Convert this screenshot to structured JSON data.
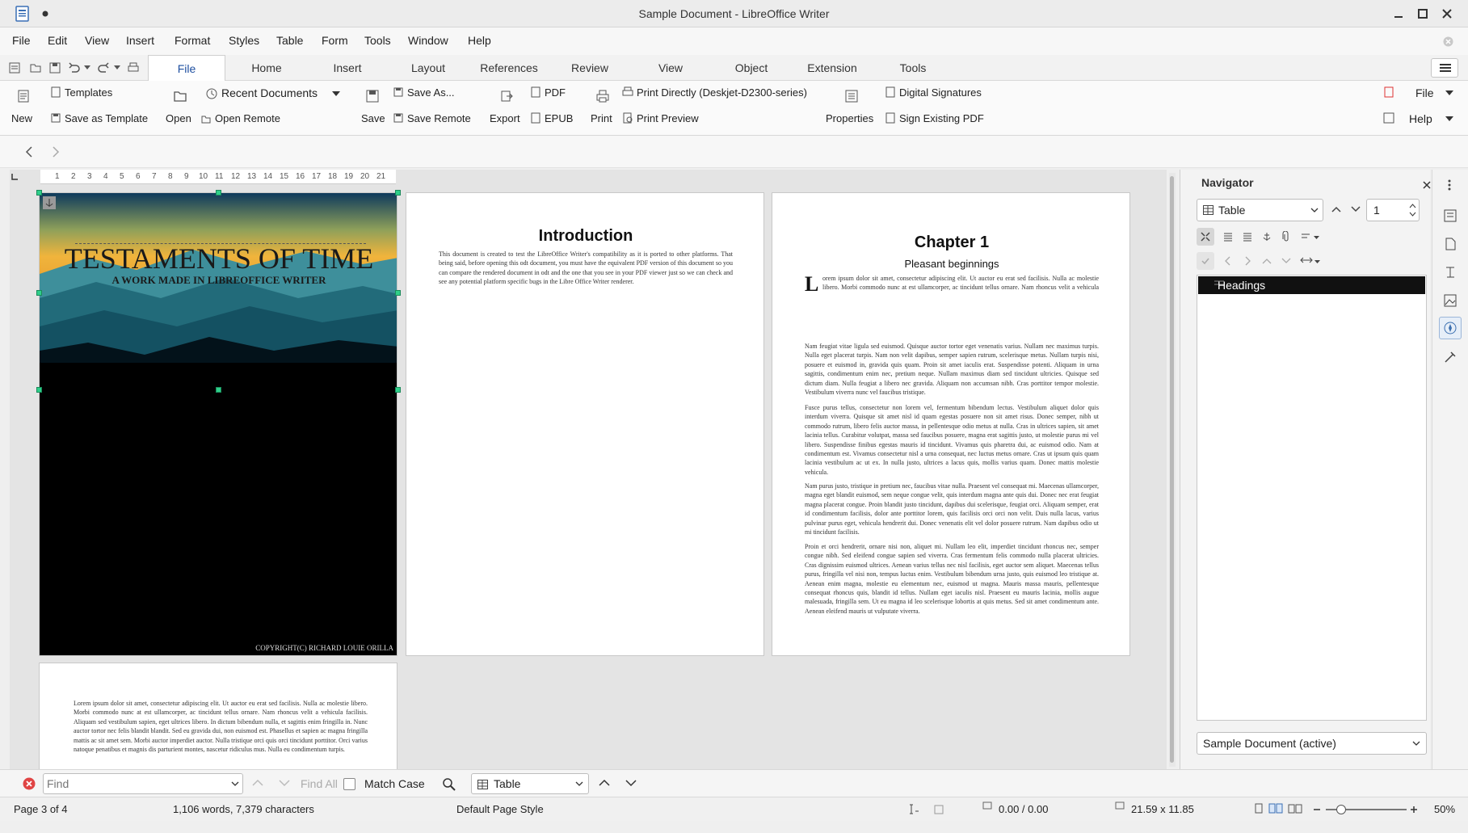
{
  "window": {
    "title": "Sample Document - LibreOffice Writer"
  },
  "menu": [
    "File",
    "Edit",
    "View",
    "Insert",
    "Format",
    "Styles",
    "Table",
    "Form",
    "Tools",
    "Window",
    "Help"
  ],
  "tabs": [
    "File",
    "Home",
    "Insert",
    "Layout",
    "References",
    "Review",
    "View",
    "Object",
    "Extension",
    "Tools"
  ],
  "ribbon": {
    "new": "New",
    "templates": "Templates",
    "save_as_template": "Save as Template",
    "open": "Open",
    "recent_documents": "Recent Documents",
    "open_remote": "Open Remote",
    "save": "Save",
    "save_as": "Save As...",
    "save_remote": "Save Remote",
    "export": "Export",
    "pdf": "PDF",
    "epub": "EPUB",
    "print": "Print",
    "print_directly": "Print Directly (Deskjet-D2300-series)",
    "print_preview": "Print Preview",
    "properties": "Properties",
    "digital_signatures": "Digital Signatures",
    "sign_existing_pdf": "Sign Existing PDF",
    "file_menu": "File",
    "help_menu": "Help"
  },
  "ruler": [
    "1",
    "2",
    "3",
    "4",
    "5",
    "6",
    "7",
    "8",
    "9",
    "10",
    "11",
    "12",
    "13",
    "14",
    "15",
    "16",
    "17",
    "18",
    "19",
    "20",
    "21"
  ],
  "cover": {
    "title": "TESTAMENTS OF TIME",
    "subtitle": "A WORK MADE IN LIBREOFFICE WRITER",
    "copyright": "COPYRIGHT(C) RICHARD LOUIE ORILLA"
  },
  "intro": {
    "heading": "Introduction",
    "text": "This document is created to test the LibreOffice Writer's compatibility as it is ported to other platforms. That being said, before opening this odt document, you must have the equivalent PDF version of this document so you can compare the rendered document in odt and the one that you see in your PDF viewer just so we can check and see any potential platform specific bugs in the Libre Office Writer renderer."
  },
  "chapter": {
    "heading": "Chapter 1",
    "subheading": "Pleasant beginnings",
    "dropcap": "L",
    "p1": "orem ipsum dolor sit amet, consectetur adipiscing elit. Ut auctor eu erat sed facilisis. Nulla ac molestie libero. Morbi commodo nunc at est ullamcorper, ac tincidunt tellus ornare. Nam rhoncus velit a vehicula facilisis. Aliquam sed vestibulum sapien, eget ultrices libero. In dictum bibendum nulla, et sagittis enim fringilla in. Nunc auctor tortor nec felis blandit blandit. Sed eu gravida dui, non euismod est. Phasellus et sapien ac magna fringilla mattis ac sit amet sem. Morbi auctor imperdiet auctor. Nulla tristique orci quis orci tincidunt porttitor. Orci varius natoque penatibus et magnis dis parturient montes, nascetur ridiculus mus. Nulla eu condimentum turpis.",
    "p2": "Nam feugiat vitae ligula sed euismod. Quisque auctor tortor eget venenatis varius. Nullam nec maximus turpis. Nulla eget placerat turpis. Nam non velit dapibus, semper sapien rutrum, scelerisque metus. Nullam turpis nisi, posuere et euismod in, gravida quis quam. Proin sit amet iaculis erat. Suspendisse potenti. Aliquam in urna sagittis, condimentum enim nec, pretium neque. Nullam maximus diam sed tincidunt ultricies. Quisque sed dictum diam. Nulla feugiat a libero nec gravida. Aliquam non accumsan nibh. Cras porttitor tempor molestie. Vestibulum viverra nunc vel faucibus tristique.",
    "p3": "Fusce purus tellus, consectetur non lorem vel, fermentum bibendum lectus. Vestibulum aliquet dolor quis interdum viverra. Quisque sit amet nisl id quam egestas posuere non sit amet risus. Donec semper, nibh ut commodo rutrum, libero felis auctor massa, in pellentesque odio metus at nulla. Cras in ultrices sapien, sit amet lacinia tellus. Curabitur volutpat, massa sed faucibus posuere, magna erat sagittis justo, ut molestie purus mi vel libero. Suspendisse finibus egestas mauris id tincidunt. Vivamus quis pharetra dui, ac euismod odio. Nam at condimentum est. Vivamus consectetur nisl a urna consequat, nec luctus metus ornare. Cras ut ipsum quis quam lacinia vestibulum ac ut ex. In nulla justo, ultrices a lacus quis, mollis varius quam. Donec mattis molestie vehicula.",
    "p4": "Nam purus justo, tristique in pretium nec, faucibus vitae nulla. Praesent vel consequat mi. Maecenas ullamcorper, magna eget blandit euismod, sem neque congue velit, quis interdum magna ante quis dui. Donec nec erat feugiat magna placerat congue. Proin blandit justo tincidunt, dapibus dui scelerisque, feugiat orci. Aliquam semper, erat id condimentum facilisis, dolor ante porttitor lorem, quis facilisis orci orci non velit. Duis nulla lacus, varius pulvinar purus eget, vehicula hendrerit dui. Donec venenatis elit vel dolor posuere rutrum. Nam dapibus odio ut mi tincidunt facilisis.",
    "p5": "Proin et orci hendrerit, ornare nisi non, aliquet mi. Nullam leo elit, imperdiet tincidunt rhoncus nec, semper congue nibh. Sed eleifend congue sapien sed viverra. Cras fermentum felis commodo nulla placerat ultricies. Cras dignissim euismod ultrices. Aenean varius tellus nec nisl facilisis, eget auctor sem aliquet. Maecenas tellus purus, fringilla vel nisi non, tempus luctus enim. Vestibulum bibendum urna justo, quis euismod leo tristique at. Aenean enim magna, molestie eu elementum nec, euismod ut magna. Mauris massa mauris, pellentesque consequat rhoncus quis, blandit id tellus. Nullam eget iaculis nisl. Praesent eu mauris lacinia, mollis augue malesuada, fringilla sem. Ut eu magna id leo scelerisque lobortis at quis metus. Sed sit amet condimentum ante. Aenean eleifend mauris ut vulputate viverra."
  },
  "page4": {
    "text": "Lorem ipsum dolor sit amet, consectetur adipiscing elit. Ut auctor eu erat sed facilisis. Nulla ac molestie libero. Morbi commodo nunc at est ullamcorper, ac tincidunt tellus ornare. Nam rhoncus velit a vehicula facilisis. Aliquam sed vestibulum sapien, eget ultrices libero. In dictum bibendum nulla, et sagittis enim fringilla in. Nunc auctor tortor nec felis blandit blandit. Sed eu gravida dui, non euismod est. Phasellus et sapien ac magna fringilla mattis ac sit amet sem. Morbi auctor imperdiet auctor. Nulla tristique orci quis orci tincidunt porttitor. Orci varius natoque penatibus et magnis dis parturient montes, nascetur ridiculus mus. Nulla eu condimentum turpis."
  },
  "navigator": {
    "title": "Navigator",
    "category": "Table",
    "page_number": "1",
    "tree_item": "Headings",
    "document": "Sample Document (active)"
  },
  "findbar": {
    "placeholder": "Find",
    "find_all": "Find All",
    "match_case": "Match Case",
    "search_type": "Table"
  },
  "status": {
    "page": "Page 3 of 4",
    "words": "1,106 words, 7,379 characters",
    "page_style": "Default Page Style",
    "position": "0.00 / 0.00",
    "size": "21.59 x 11.85",
    "zoom": "50%"
  }
}
